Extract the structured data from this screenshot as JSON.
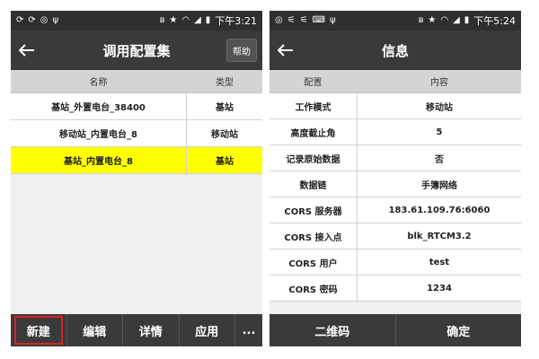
{
  "left": {
    "status": {
      "time": "下午3:21"
    },
    "title": "调用配置集",
    "help_label": "帮助",
    "columns": [
      "名称",
      "类型"
    ],
    "rows": [
      {
        "name": "基站_外置电台_38400",
        "type": "基站"
      },
      {
        "name": "移动站_内置电台_8",
        "type": "移动站"
      },
      {
        "name": "基站_内置电台_8",
        "type": "基站"
      }
    ],
    "selected_row_color": "#ffff00",
    "buttons": {
      "new": "新建",
      "edit": "编辑",
      "details": "详情",
      "apply": "应用",
      "more": "..."
    }
  },
  "right": {
    "status": {
      "time": "下午5:24"
    },
    "title": "信息",
    "columns": [
      "配置",
      "内容"
    ],
    "rows": [
      {
        "key": "工作模式",
        "value": "移动站"
      },
      {
        "key": "高度截止角",
        "value": "5"
      },
      {
        "key": "记录原始数据",
        "value": "否"
      },
      {
        "key": "数据链",
        "value": "手簿网络"
      },
      {
        "key": "CORS 服务器",
        "value": "183.61.109.76:6060"
      },
      {
        "key": "CORS 接入点",
        "value": "blk_RTCM3.2"
      },
      {
        "key": "CORS 用户",
        "value": "test"
      },
      {
        "key": "CORS 密码",
        "value": "1234"
      }
    ],
    "buttons": {
      "qr": "二维码",
      "confirm": "确定"
    }
  },
  "icons": {
    "back": "arrow-left-icon",
    "bluetooth": "bluetooth-icon",
    "star": "star-icon",
    "wifi": "wifi-icon",
    "signal": "signal-icon",
    "battery": "battery-icon"
  }
}
